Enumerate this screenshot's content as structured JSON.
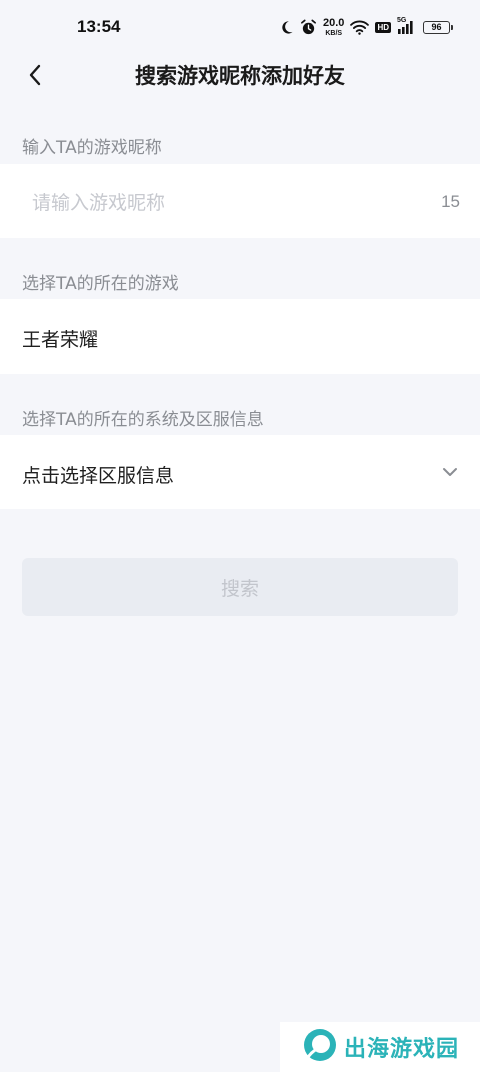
{
  "status_bar": {
    "time": "13:54",
    "net_speed_value": "20.0",
    "net_speed_unit": "KB/S",
    "hd_label": "HD",
    "signal_label": "5G",
    "battery_level": "96"
  },
  "header": {
    "title": "搜索游戏昵称添加好友"
  },
  "nickname_section": {
    "label": "输入TA的游戏昵称",
    "placeholder": "请输入游戏昵称",
    "value": "",
    "char_limit": "15"
  },
  "game_section": {
    "label": "选择TA的所在的游戏",
    "value": "王者荣耀"
  },
  "server_section": {
    "label": "选择TA的所在的系统及区服信息",
    "value": "点击选择区服信息"
  },
  "search_button": {
    "label": "搜索"
  },
  "watermark": {
    "text": "出海游戏园"
  },
  "colors": {
    "background": "#f5f6fa",
    "card": "#ffffff",
    "label_gray": "#8a8d93",
    "placeholder_gray": "#c7c9cf",
    "button_disabled_bg": "#e9ecf2",
    "button_disabled_text": "#c2c5cc",
    "watermark_teal": "#2bb3b8"
  },
  "icons": {
    "back": "back-arrow-icon",
    "chevron": "chevron-down-icon",
    "moon": "moon-icon",
    "alarm": "alarm-icon",
    "wifi": "wifi-icon",
    "signal": "signal-icon",
    "battery": "battery-icon"
  }
}
